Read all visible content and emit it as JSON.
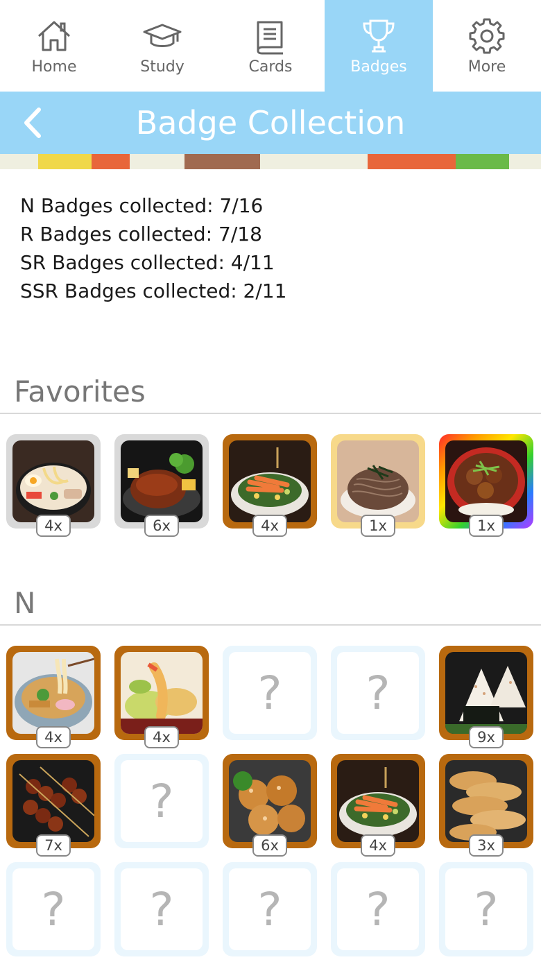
{
  "tabs": [
    {
      "label": "Home",
      "icon": "home-icon",
      "active": false
    },
    {
      "label": "Study",
      "icon": "graduation-cap-icon",
      "active": false
    },
    {
      "label": "Cards",
      "icon": "book-icon",
      "active": false
    },
    {
      "label": "Badges",
      "icon": "trophy-icon",
      "active": true
    },
    {
      "label": "More",
      "icon": "gear-icon",
      "active": false
    }
  ],
  "header": {
    "title": "Badge Collection",
    "back_icon": "chevron-left-icon"
  },
  "colors": {
    "accent": "#99d6f7",
    "bronze": "#b8690f",
    "silver": "#d9d9d9",
    "gold": "#f7d98a"
  },
  "stats": [
    "N Badges collected: 7/16",
    "R Badges collected: 7/18",
    "SR Badges collected: 4/11",
    "SSR Badges collected: 2/11"
  ],
  "favorites": {
    "title": "Favorites",
    "badges": [
      {
        "food": "ramen",
        "frame": "silver",
        "count": "4x"
      },
      {
        "food": "hamburg-steak",
        "frame": "silver",
        "count": "6x"
      },
      {
        "food": "salad-bowl",
        "frame": "bronze",
        "count": "4x"
      },
      {
        "food": "soba",
        "frame": "gold",
        "count": "1x"
      },
      {
        "food": "beef-bowl",
        "frame": "rainbow",
        "count": "1x"
      }
    ]
  },
  "n_section": {
    "title": "N",
    "badges": [
      {
        "food": "udon",
        "frame": "bronze",
        "count": "4x",
        "locked": false
      },
      {
        "food": "tempura",
        "frame": "bronze",
        "count": "4x",
        "locked": false
      },
      {
        "locked": true,
        "label": "?"
      },
      {
        "locked": true,
        "label": "?"
      },
      {
        "food": "onigiri",
        "frame": "bronze",
        "count": "9x",
        "locked": false
      },
      {
        "food": "yakitori",
        "frame": "bronze",
        "count": "7x",
        "locked": false
      },
      {
        "locked": true,
        "label": "?"
      },
      {
        "food": "karaage",
        "frame": "bronze",
        "count": "6x",
        "locked": false
      },
      {
        "food": "salad-bowl",
        "frame": "bronze",
        "count": "4x",
        "locked": false
      },
      {
        "food": "gyoza",
        "frame": "bronze",
        "count": "3x",
        "locked": false
      },
      {
        "locked": true,
        "label": "?"
      },
      {
        "locked": true,
        "label": "?"
      },
      {
        "locked": true,
        "label": "?"
      },
      {
        "locked": true,
        "label": "?"
      },
      {
        "locked": true,
        "label": "?"
      }
    ]
  }
}
